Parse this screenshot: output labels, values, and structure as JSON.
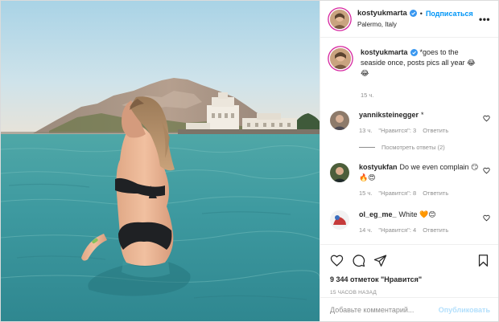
{
  "header": {
    "username": "kostyukmarta",
    "dot": "•",
    "follow_label": "Подписаться",
    "location": "Palermo, Italy",
    "more_label": "•••"
  },
  "caption": {
    "username": "kostyukmarta",
    "text": "*goes to the seaside once, posts pics all year 😂😂",
    "time": "15 ч."
  },
  "comments": [
    {
      "author": "yanniksteinegger",
      "text": "*",
      "time": "13 ч.",
      "likes": "\"Нравится\": 3",
      "reply": "Ответить"
    },
    {
      "author": "kostyukfan",
      "text": "Do we even complain 😏🔥😍",
      "time": "15 ч.",
      "likes": "\"Нравится\": 8",
      "reply": "Ответить"
    },
    {
      "author": "ol_eg_me_",
      "text": "White 🧡😊",
      "time": "14 ч.",
      "likes": "\"Нравится\": 4",
      "reply": "Ответить"
    }
  ],
  "view_replies": "Посмотреть ответы (2)",
  "actions": {
    "likes_count": "9 344 отметок \"Нравится\"",
    "posted_ago": "15 ЧАСОВ НАЗАД"
  },
  "add_comment": {
    "placeholder": "Добавьте комментарий...",
    "publish_label": "Опубликовать"
  },
  "colors": {
    "link_blue": "#0095f6",
    "publish_disabled": "#b2dffc",
    "meta_gray": "#8e8e8e",
    "story_ring": "#d6249f"
  },
  "icons": [
    "verified-badge-icon",
    "more-options-icon",
    "heart-icon",
    "comment-icon",
    "share-icon",
    "bookmark-icon"
  ]
}
